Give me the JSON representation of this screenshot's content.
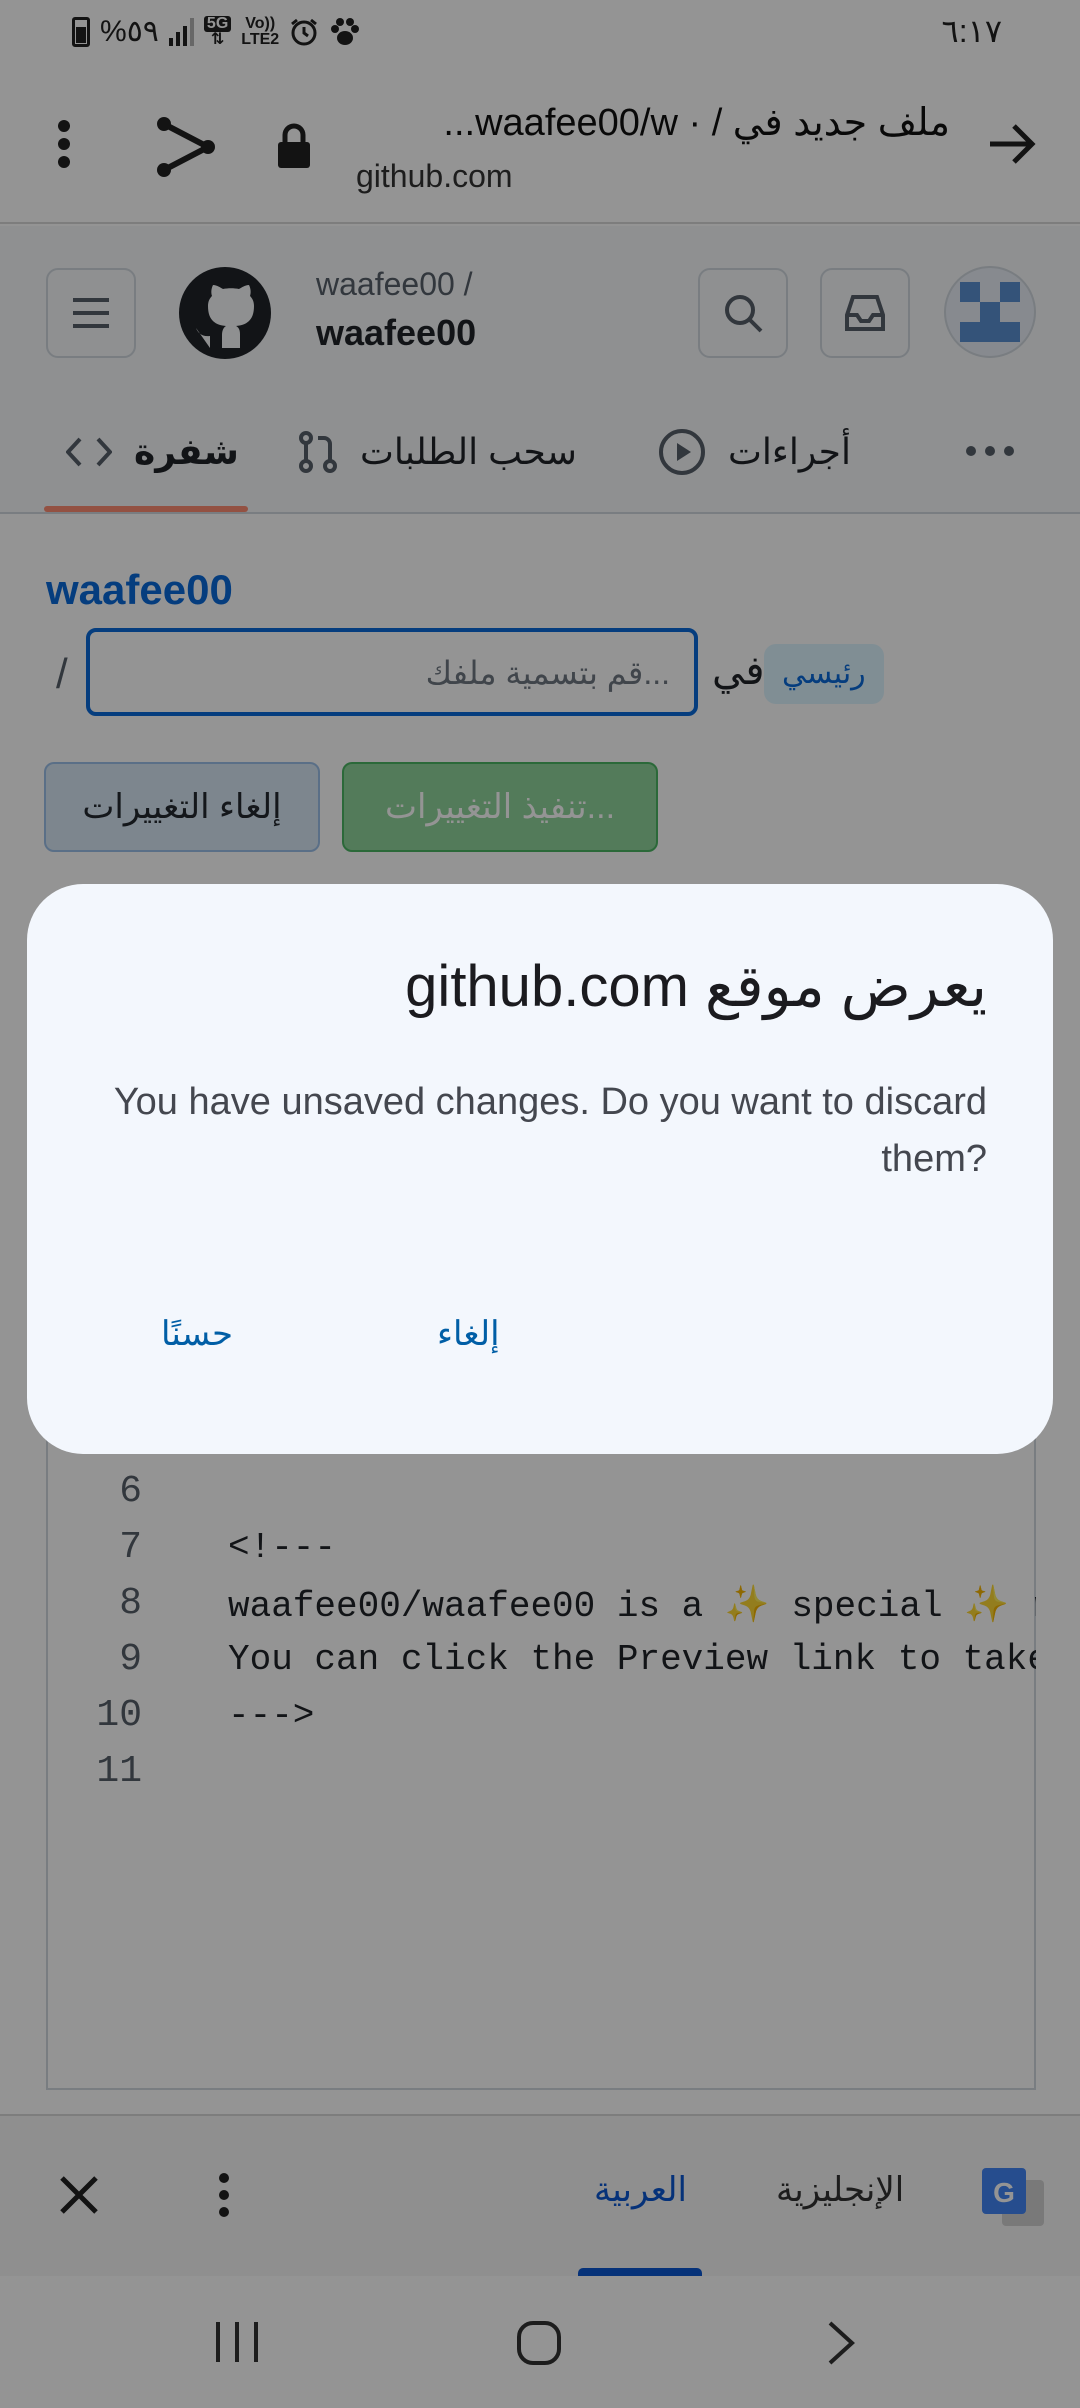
{
  "status_bar": {
    "battery_text": "%٥٩",
    "network_5g": "5G",
    "volte": "Vo))",
    "lte": "LTE2",
    "time": "٦:١٧"
  },
  "browser": {
    "title": "ملف جديد في / · waafee00/w...",
    "url": "github.com"
  },
  "github": {
    "owner": "waafee00 /",
    "repo": "waafee00",
    "tabs": [
      {
        "label": "شفرة"
      },
      {
        "label": "سحب الطلبات"
      },
      {
        "label": "أجراءات"
      }
    ]
  },
  "editor_page": {
    "repo_link": "waafee00",
    "slash": "/",
    "filename_placeholder": "...قم بتسمية ملفك",
    "in_label": "في",
    "branch": "رئيسي",
    "cancel_label": "إلغاء التغييرات",
    "commit_label": "...تنفيذ التغييرات"
  },
  "code_lines": [
    {
      "num": "6",
      "text": ""
    },
    {
      "num": "7",
      "text": "<!---"
    },
    {
      "num": "8",
      "text_a": "waafee00/waafee00 is a ",
      "spark": "✨",
      "text_b": " special ",
      "spark2": "✨",
      "text_c": " rep"
    },
    {
      "num": "9",
      "text": "You can click the Preview link to take a"
    },
    {
      "num": "10",
      "text": "--->"
    },
    {
      "num": "11",
      "text": ""
    }
  ],
  "dialog": {
    "title": "يعرض موقع github.com",
    "message": "You have unsaved changes. Do you want to discard them?",
    "ok_label": "حسنًا",
    "cancel_label": "إلغاء"
  },
  "translate_bar": {
    "english": "الإنجليزية",
    "arabic": "العربية"
  },
  "colors": {
    "accent_blue": "#0969da",
    "tab_underline": "#fd8c73",
    "dialog_bg": "#f3f7fd",
    "dialog_button": "#005ea6"
  }
}
